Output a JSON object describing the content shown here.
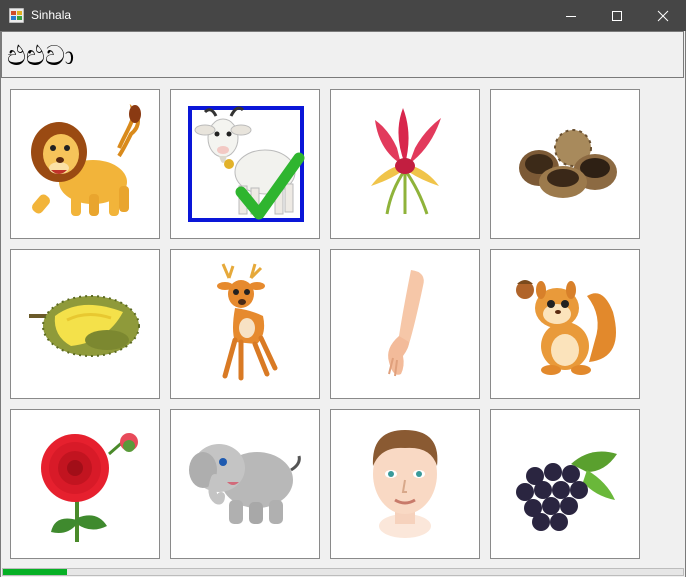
{
  "window": {
    "title": "Sinhala",
    "minimize_icon": "minimize-icon",
    "maximize_icon": "maximize-icon",
    "close_icon": "close-icon"
  },
  "header": {
    "word": "එළුවා"
  },
  "grid": {
    "tiles": [
      {
        "icon": "lion-icon",
        "selected": false
      },
      {
        "icon": "goat-icon",
        "selected": true
      },
      {
        "icon": "flower-icon",
        "selected": false
      },
      {
        "icon": "nuts-icon",
        "selected": false
      },
      {
        "icon": "durian-icon",
        "selected": false
      },
      {
        "icon": "deer-icon",
        "selected": false
      },
      {
        "icon": "arm-icon",
        "selected": false
      },
      {
        "icon": "squirrel-icon",
        "selected": false
      },
      {
        "icon": "dahlia-icon",
        "selected": false
      },
      {
        "icon": "elephant-icon",
        "selected": false
      },
      {
        "icon": "boy-face-icon",
        "selected": false
      },
      {
        "icon": "grapes-icon",
        "selected": false
      }
    ],
    "selection_color": "#0a16d8",
    "checkmark_color": "#2fb52f"
  },
  "progress": {
    "value": 0.094,
    "color": "#06b025"
  }
}
